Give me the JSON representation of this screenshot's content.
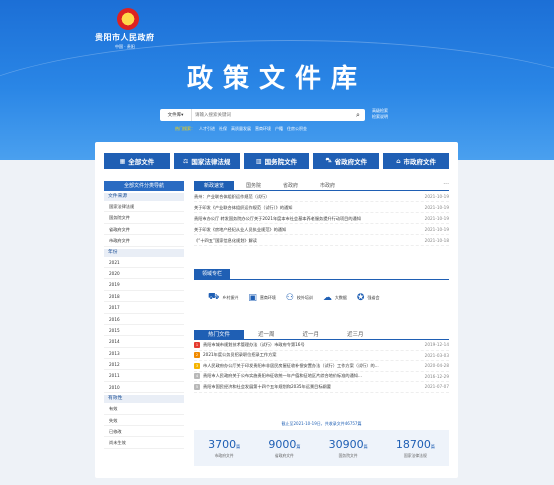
{
  "header": {
    "site_name": "贵阳市人民政府",
    "site_sub": "中国 · 贵阳",
    "title": "政策文件库"
  },
  "search": {
    "select_value": "文件库",
    "placeholder": "请输入搜索关键词",
    "advanced": "高级检索",
    "search_tips": "检索说明",
    "hot_label": "热门搜索：",
    "hot_words": [
      "人才引进",
      "社保",
      "高质量发展",
      "营商环境",
      "户籍",
      "住房公积金"
    ]
  },
  "categories": [
    {
      "label": "全部文件",
      "icon": "list-icon",
      "glyph": "▦"
    },
    {
      "label": "国家法律法规",
      "icon": "scale-icon",
      "glyph": "⚖"
    },
    {
      "label": "国务院文件",
      "icon": "building-icon",
      "glyph": "▥"
    },
    {
      "label": "省政府文件",
      "icon": "car-icon",
      "glyph": "⛍"
    },
    {
      "label": "市政府文件",
      "icon": "bank-icon",
      "glyph": "⌂"
    }
  ],
  "sidebar": {
    "head": "全部文件分类导航",
    "sections": [
      {
        "title": "文件来源",
        "items": [
          "国家法律法规",
          "国务院文件",
          "省政府文件",
          "市政府文件"
        ]
      },
      {
        "title": "年份",
        "items": [
          "2021",
          "2020",
          "2019",
          "2018",
          "2017",
          "2016",
          "2015",
          "2014",
          "2013",
          "2012",
          "2011",
          "2010"
        ]
      },
      {
        "title": "有效性",
        "items": [
          "有效",
          "失效",
          "已修改",
          "尚未生效"
        ]
      }
    ]
  },
  "news": {
    "tabs": [
      "新政速览",
      "国务院",
      "省政府",
      "市政府"
    ],
    "more": "···",
    "rows": [
      {
        "title": "贵州：产业联合体组织运作规范（试行）",
        "date": "2021-10-19"
      },
      {
        "title": "关于印发《产业联合体组织运作规范（试行）》的通知",
        "date": "2021-10-19"
      },
      {
        "title": "贵阳市办公厅 转发国务院办公厅关于2021年度本市社会基本养老服务提升行动项目的通知",
        "date": "2021-10-19"
      },
      {
        "title": "关于印发《房地产经纪从业人员执业规范》的通知",
        "date": "2021-10-19"
      },
      {
        "title": "《“十四五”国家信息化规划》解读",
        "date": "2021-10-18"
      }
    ]
  },
  "fields": {
    "title": "领域专栏",
    "items": [
      {
        "label": "乡村振兴",
        "icon": "truck-icon",
        "glyph": "⛟"
      },
      {
        "label": "营商环境",
        "icon": "briefcase-icon",
        "glyph": "▣"
      },
      {
        "label": "校外培训",
        "icon": "person-icon",
        "glyph": "⚇"
      },
      {
        "label": "大数据",
        "icon": "cloud-icon",
        "glyph": "☁"
      },
      {
        "label": "强省会",
        "icon": "medal-icon",
        "glyph": "✪"
      }
    ]
  },
  "hot": {
    "tabs": [
      "热门文件",
      "近一周",
      "近一月",
      "近三月"
    ],
    "rows": [
      {
        "rank": "1",
        "color": "#e53b2f",
        "title": "贵阳市城市规划技术管理办法（试行）市政府令第16号",
        "date": "2019-12-14"
      },
      {
        "rank": "2",
        "color": "#f08a00",
        "title": "2021年度公务员招录职位招录工作方案",
        "date": "2021-03-03"
      },
      {
        "rank": "3",
        "color": "#f5b400",
        "title": "市人民政府办公厅关于印发贵阳市非居民房屋征收补偿安置办法（试行）工作方案（试行）的...",
        "date": "2020-04-28"
      },
      {
        "rank": "4",
        "color": "#b8b8b8",
        "title": "贵阳市人民政府关于公布实施贵阳市征收统一年产值和征地区片综合地价标准的通知...",
        "date": "2016-12-29"
      },
      {
        "rank": "5",
        "color": "#b8b8b8",
        "title": "贵阳市国民经济和社会发展第十四个五年规划和2035年远景目标纲要",
        "date": "2021-07-07"
      }
    ]
  },
  "deadline": "截止至2021-10-19日，共收录文件46757篇",
  "stats": [
    {
      "value": "3700",
      "unit": "篇",
      "label": "市政府文件"
    },
    {
      "value": "9000",
      "unit": "篇",
      "label": "省政府文件"
    },
    {
      "value": "30900",
      "unit": "篇",
      "label": "国务院文件"
    },
    {
      "value": "18700",
      "unit": "篇",
      "label": "国家法律法规"
    }
  ]
}
